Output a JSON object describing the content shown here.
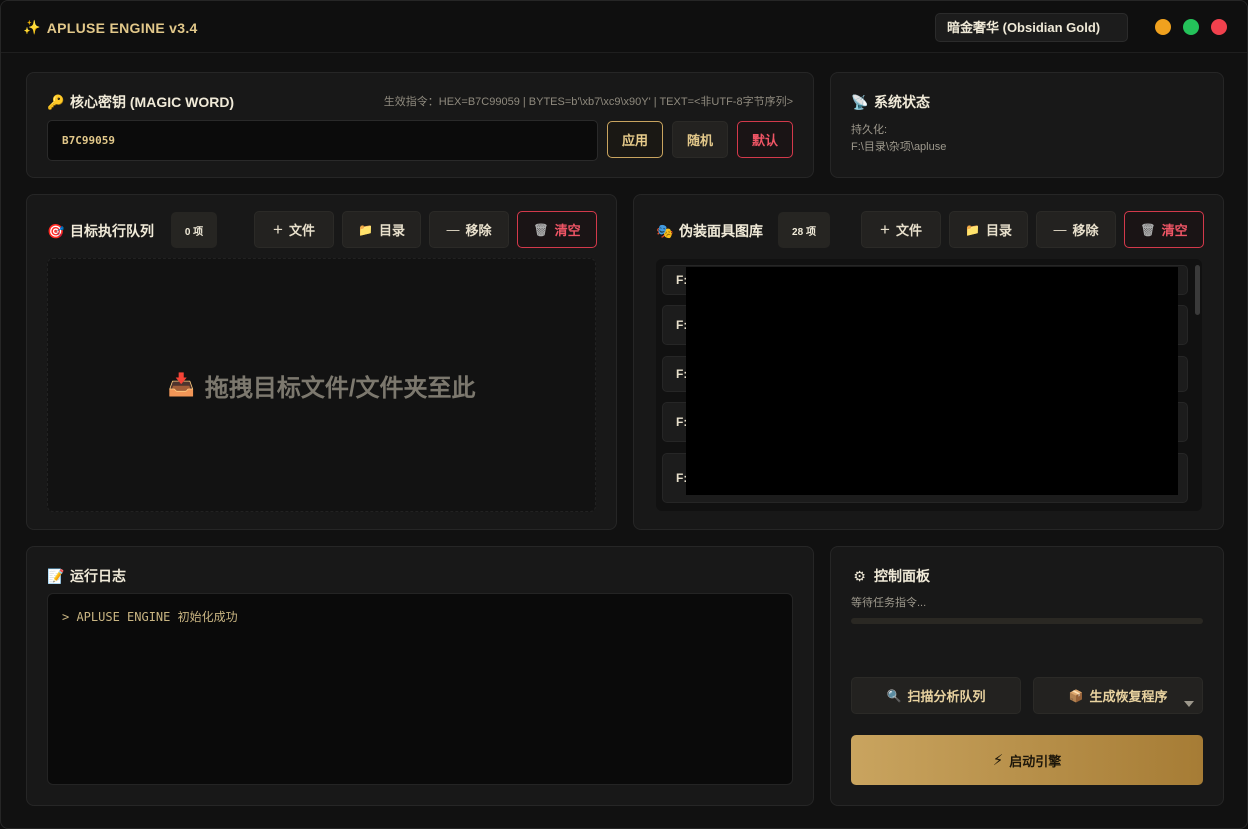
{
  "app": {
    "title": "APLUSE ENGINE v3.4",
    "theme": "暗金奢华 (Obsidian Gold)"
  },
  "key_panel": {
    "title": "核心密钥 (MAGIC WORD)",
    "hint": "生效指令：HEX=B7C99059 | BYTES=b'\\xb7\\xc9\\x90Y' | TEXT=<非UTF-8字节序列>",
    "value": "B7C99059",
    "apply": "应用",
    "random": "随机",
    "default": "默认"
  },
  "status_panel": {
    "title": "系统状态",
    "persist_label": "持久化:",
    "persist_path": "F:\\目录\\杂项\\apluse"
  },
  "target_panel": {
    "title": "目标执行队列",
    "count": "0 项",
    "add_file": "文件",
    "add_dir": "目录",
    "remove": "移除",
    "clear": "清空",
    "drop_hint": "拖拽目标文件/文件夹至此"
  },
  "mask_panel": {
    "title": "伪装面具图库",
    "count": "28 项",
    "add_file": "文件",
    "add_dir": "目录",
    "remove": "移除",
    "clear": "清空",
    "items": [
      "F:",
      "F:",
      "F:",
      "F:",
      "F:"
    ]
  },
  "log_panel": {
    "title": "运行日志",
    "lines": [
      "> APLUSE ENGINE 初始化成功"
    ]
  },
  "control_panel": {
    "title": "控制面板",
    "status": "等待任务指令...",
    "progress": 0,
    "scan": "扫描分析队列",
    "build": "生成恢复程序",
    "launch": "启动引擎"
  },
  "colors": {
    "accent": "#c9a45f",
    "danger": "#ef5565",
    "background": "#111111"
  }
}
